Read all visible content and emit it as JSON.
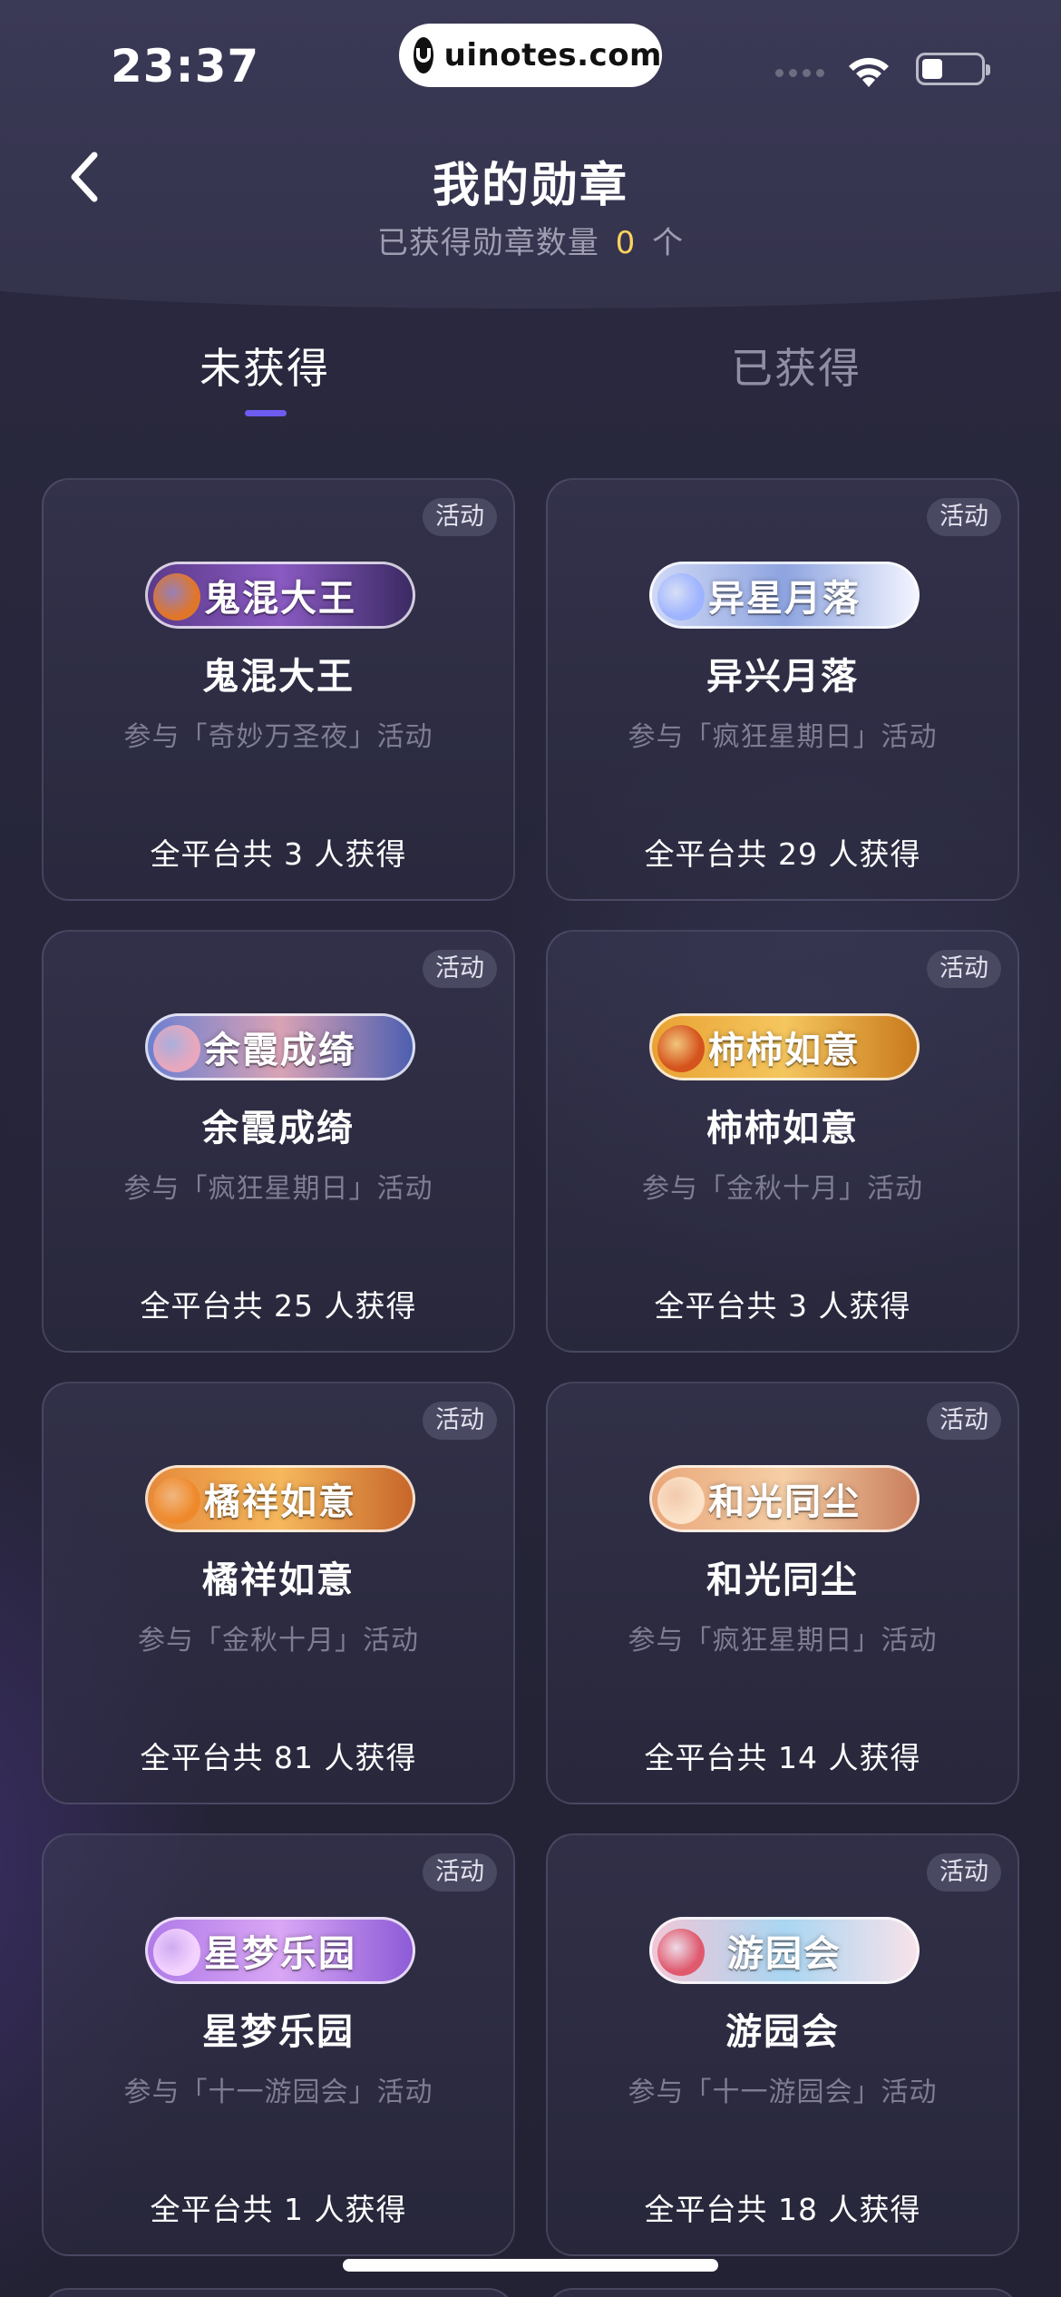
{
  "status": {
    "time": "23:37",
    "url": "uinotes.com"
  },
  "header": {
    "title": "我的勋章",
    "subtitle_prefix": "已获得勋章数量",
    "count": "0",
    "subtitle_suffix": "个"
  },
  "tabs": [
    {
      "label": "未获得",
      "active": true
    },
    {
      "label": "已获得",
      "active": false
    }
  ],
  "tag_label": "活动",
  "medals": [
    {
      "badge_text": "鬼混大王",
      "name": "鬼混大王",
      "desc": "参与「奇妙万圣夜」活动",
      "count_text": "全平台共 3 人获得",
      "colors": [
        "#5b3a8a",
        "#8a5ac2",
        "#3b2a63"
      ],
      "deco": "#e0762a"
    },
    {
      "badge_text": "异星月落",
      "name": "异兴月落",
      "desc": "参与「疯狂星期日」活动",
      "count_text": "全平台共 29 人获得",
      "colors": [
        "#cfd8f5",
        "#8ea4e0",
        "#f2f4ff"
      ],
      "deco": "#9fb4ff"
    },
    {
      "badge_text": "余霞成绮",
      "name": "余霞成绮",
      "desc": "参与「疯狂星期日」活动",
      "count_text": "全平台共 25 人获得",
      "colors": [
        "#6c7fd0",
        "#d9a2b5",
        "#4d5fb0"
      ],
      "deco": "#e7a7bd"
    },
    {
      "badge_text": "柿柿如意",
      "name": "柿柿如意",
      "desc": "参与「金秋十月」活动",
      "count_text": "全平台共 3 人获得",
      "colors": [
        "#e9a232",
        "#f5c65e",
        "#c97a1c"
      ],
      "deco": "#d5531d"
    },
    {
      "badge_text": "橘祥如意",
      "name": "橘祥如意",
      "desc": "参与「金秋十月」活动",
      "count_text": "全平台共 81 人获得",
      "colors": [
        "#e58a3b",
        "#f6b85c",
        "#c7662a"
      ],
      "deco": "#ef8a2c"
    },
    {
      "badge_text": "和光同尘",
      "name": "和光同尘",
      "desc": "参与「疯狂星期日」活动",
      "count_text": "全平台共 14 人获得",
      "colors": [
        "#e9a77a",
        "#f6cfa6",
        "#c97e5c"
      ],
      "deco": "#fbe2c8"
    },
    {
      "badge_text": "星梦乐园",
      "name": "星梦乐园",
      "desc": "参与「十一游园会」活动",
      "count_text": "全平台共 1 人获得",
      "colors": [
        "#b07ae8",
        "#d9a7f5",
        "#8d5bd6"
      ],
      "deco": "#f3d2ff"
    },
    {
      "badge_text": "游园会",
      "name": "游园会",
      "desc": "参与「十一游园会」活动",
      "count_text": "全平台共 18 人获得",
      "colors": [
        "#f1c6d6",
        "#a9d6f2",
        "#f7e2ea"
      ],
      "deco": "#e05a6e"
    }
  ]
}
